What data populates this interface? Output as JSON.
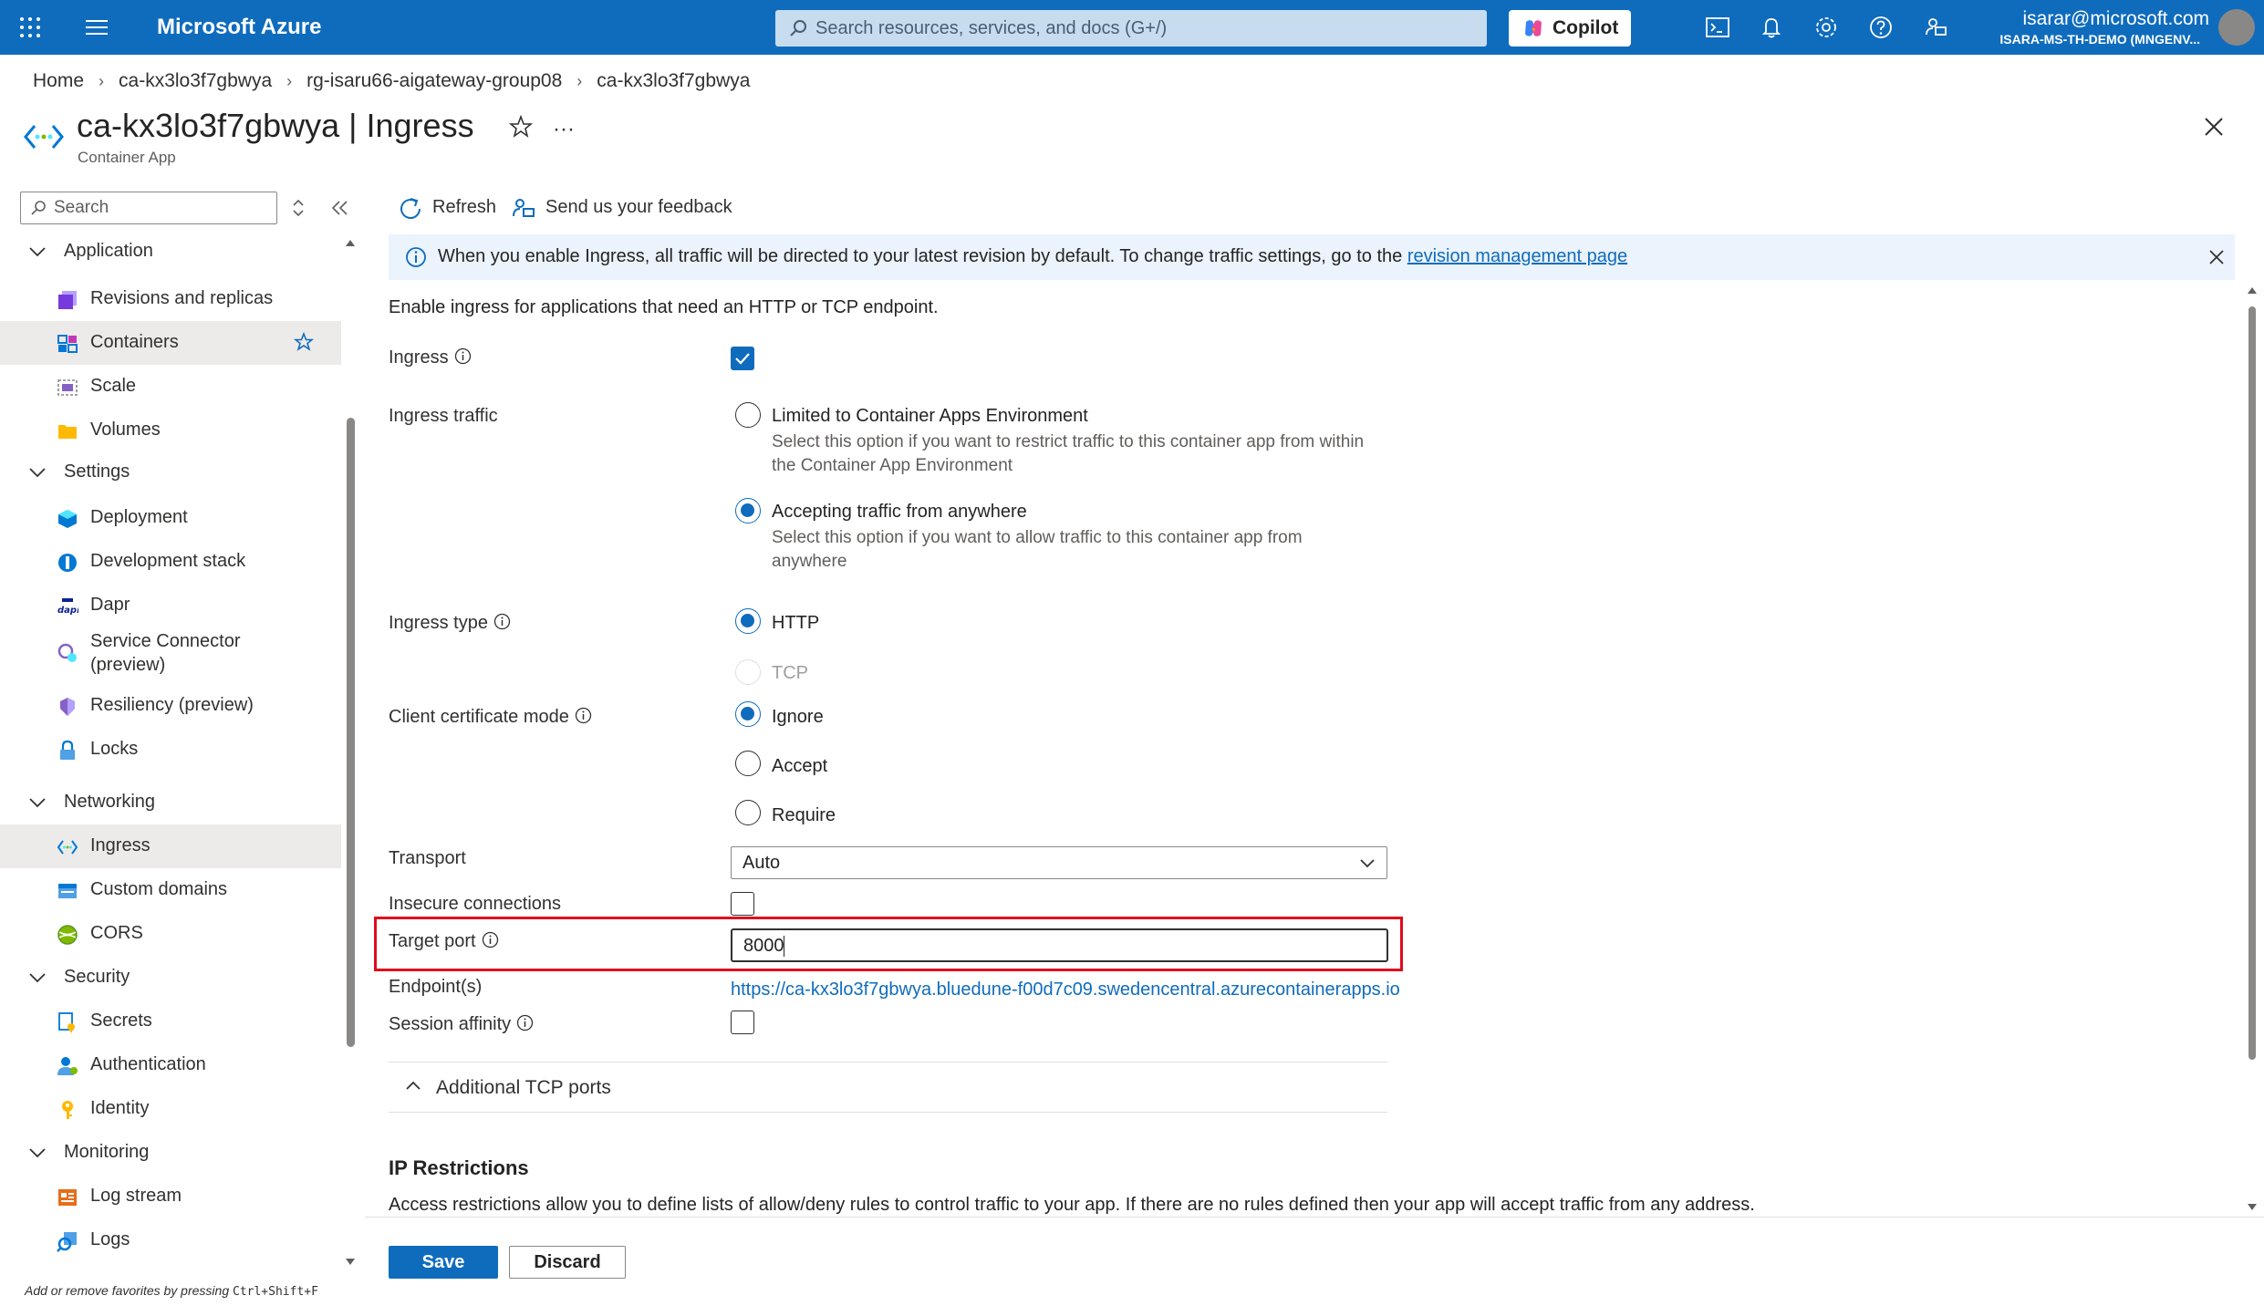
{
  "topbar": {
    "brand": "Microsoft Azure",
    "search_placeholder": "Search resources, services, and docs (G+/)",
    "copilot_label": "Copilot",
    "account_email": "isarar@microsoft.com",
    "account_directory": "ISARA-MS-TH-DEMO (MNGENV..."
  },
  "breadcrumb": [
    "Home",
    "ca-kx3lo3f7gbwya",
    "rg-isaru66-aigateway-group08",
    "ca-kx3lo3f7gbwya"
  ],
  "page": {
    "title": "ca-kx3lo3f7gbwya | Ingress",
    "subtitle": "Container App",
    "more": "···"
  },
  "sidebar": {
    "search_placeholder": "Search",
    "hint_prefix": "Add or remove favorites by pressing ",
    "hint_keys": "Ctrl+Shift+F",
    "groups": {
      "application": "Application",
      "settings": "Settings",
      "networking": "Networking",
      "security": "Security",
      "monitoring": "Monitoring"
    },
    "items": {
      "revisions": "Revisions and replicas",
      "containers": "Containers",
      "scale": "Scale",
      "volumes": "Volumes",
      "deployment": "Deployment",
      "devstack": "Development stack",
      "dapr": "Dapr",
      "service_connector_1": "Service Connector",
      "service_connector_2": "(preview)",
      "resiliency": "Resiliency (preview)",
      "locks": "Locks",
      "ingress": "Ingress",
      "custom_domains": "Custom domains",
      "cors": "CORS",
      "secrets": "Secrets",
      "authentication": "Authentication",
      "identity": "Identity",
      "log_stream": "Log stream",
      "logs": "Logs"
    }
  },
  "toolbar": {
    "refresh": "Refresh",
    "feedback": "Send us your feedback"
  },
  "banner": {
    "text": "When you enable Ingress, all traffic will be directed to your latest revision by default. To change traffic settings, go to the ",
    "link": "revision management page"
  },
  "form": {
    "intro": "Enable ingress for applications that need an HTTP or TCP endpoint.",
    "ingress_label": "Ingress",
    "ingress_traffic_label": "Ingress traffic",
    "traffic_opt1": "Limited to Container Apps Environment",
    "traffic_opt1_desc": "Select this option if you want to restrict traffic to this container app from within the Container App Environment",
    "traffic_opt2": "Accepting traffic from anywhere",
    "traffic_opt2_desc": "Select this option if you want to allow traffic to this container app from anywhere",
    "ingress_type_label": "Ingress type",
    "type_http": "HTTP",
    "type_tcp": "TCP",
    "client_cert_label": "Client certificate mode",
    "cert_ignore": "Ignore",
    "cert_accept": "Accept",
    "cert_require": "Require",
    "transport_label": "Transport",
    "transport_value": "Auto",
    "insecure_label": "Insecure connections",
    "target_port_label": "Target port",
    "target_port_value": "8000",
    "endpoints_label": "Endpoint(s)",
    "endpoint_url": "https://ca-kx3lo3f7gbwya.bluedune-f00d7c09.swedencentral.azurecontainerapps.io",
    "session_affinity_label": "Session affinity",
    "additional_tcp": "Additional TCP ports",
    "ip_title": "IP Restrictions",
    "ip_desc": "Access restrictions allow you to define lists of allow/deny rules to control traffic to your app. If there are no rules defined then your app will accept traffic from any address."
  },
  "footer": {
    "save": "Save",
    "discard": "Discard"
  }
}
